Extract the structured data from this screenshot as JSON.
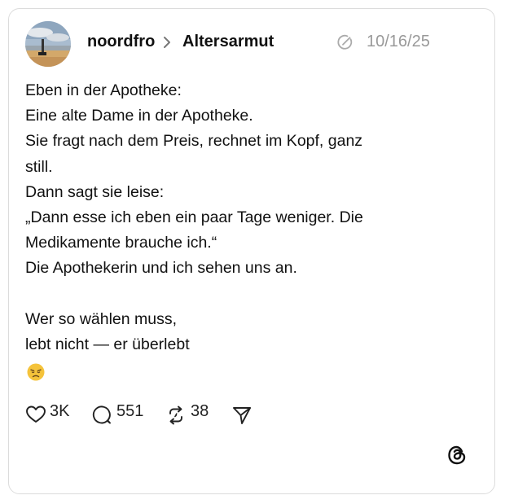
{
  "post": {
    "author": "noordfro",
    "topic": "Altersarmut",
    "timestamp": "10/16/25",
    "body_lines": [
      "Eben in der Apotheke:",
      "Eine alte Dame in der Apotheke.",
      "Sie fragt nach dem Preis, rechnet im Kopf, ganz",
      "still.",
      "Dann sagt sie leise:",
      "„Dann esse ich eben ein paar Tage weniger. Die",
      "Medikamente brauche ich.“",
      "Die Apothekerin und ich sehen uns an.",
      "",
      "Wer so wählen muss,",
      "lebt nicht — er überlebt"
    ],
    "emoji": "disappointed-face-icon"
  },
  "actions": {
    "likes": "3K",
    "replies": "551",
    "reposts": "38",
    "like_icon": "heart-icon",
    "reply_icon": "comment-icon",
    "repost_icon": "repost-icon",
    "share_icon": "send-icon"
  },
  "colors": {
    "text": "#111111",
    "muted": "#999999",
    "border": "#dcdcdc",
    "emoji": "#f5c33b"
  },
  "branding": "threads-logo-icon"
}
